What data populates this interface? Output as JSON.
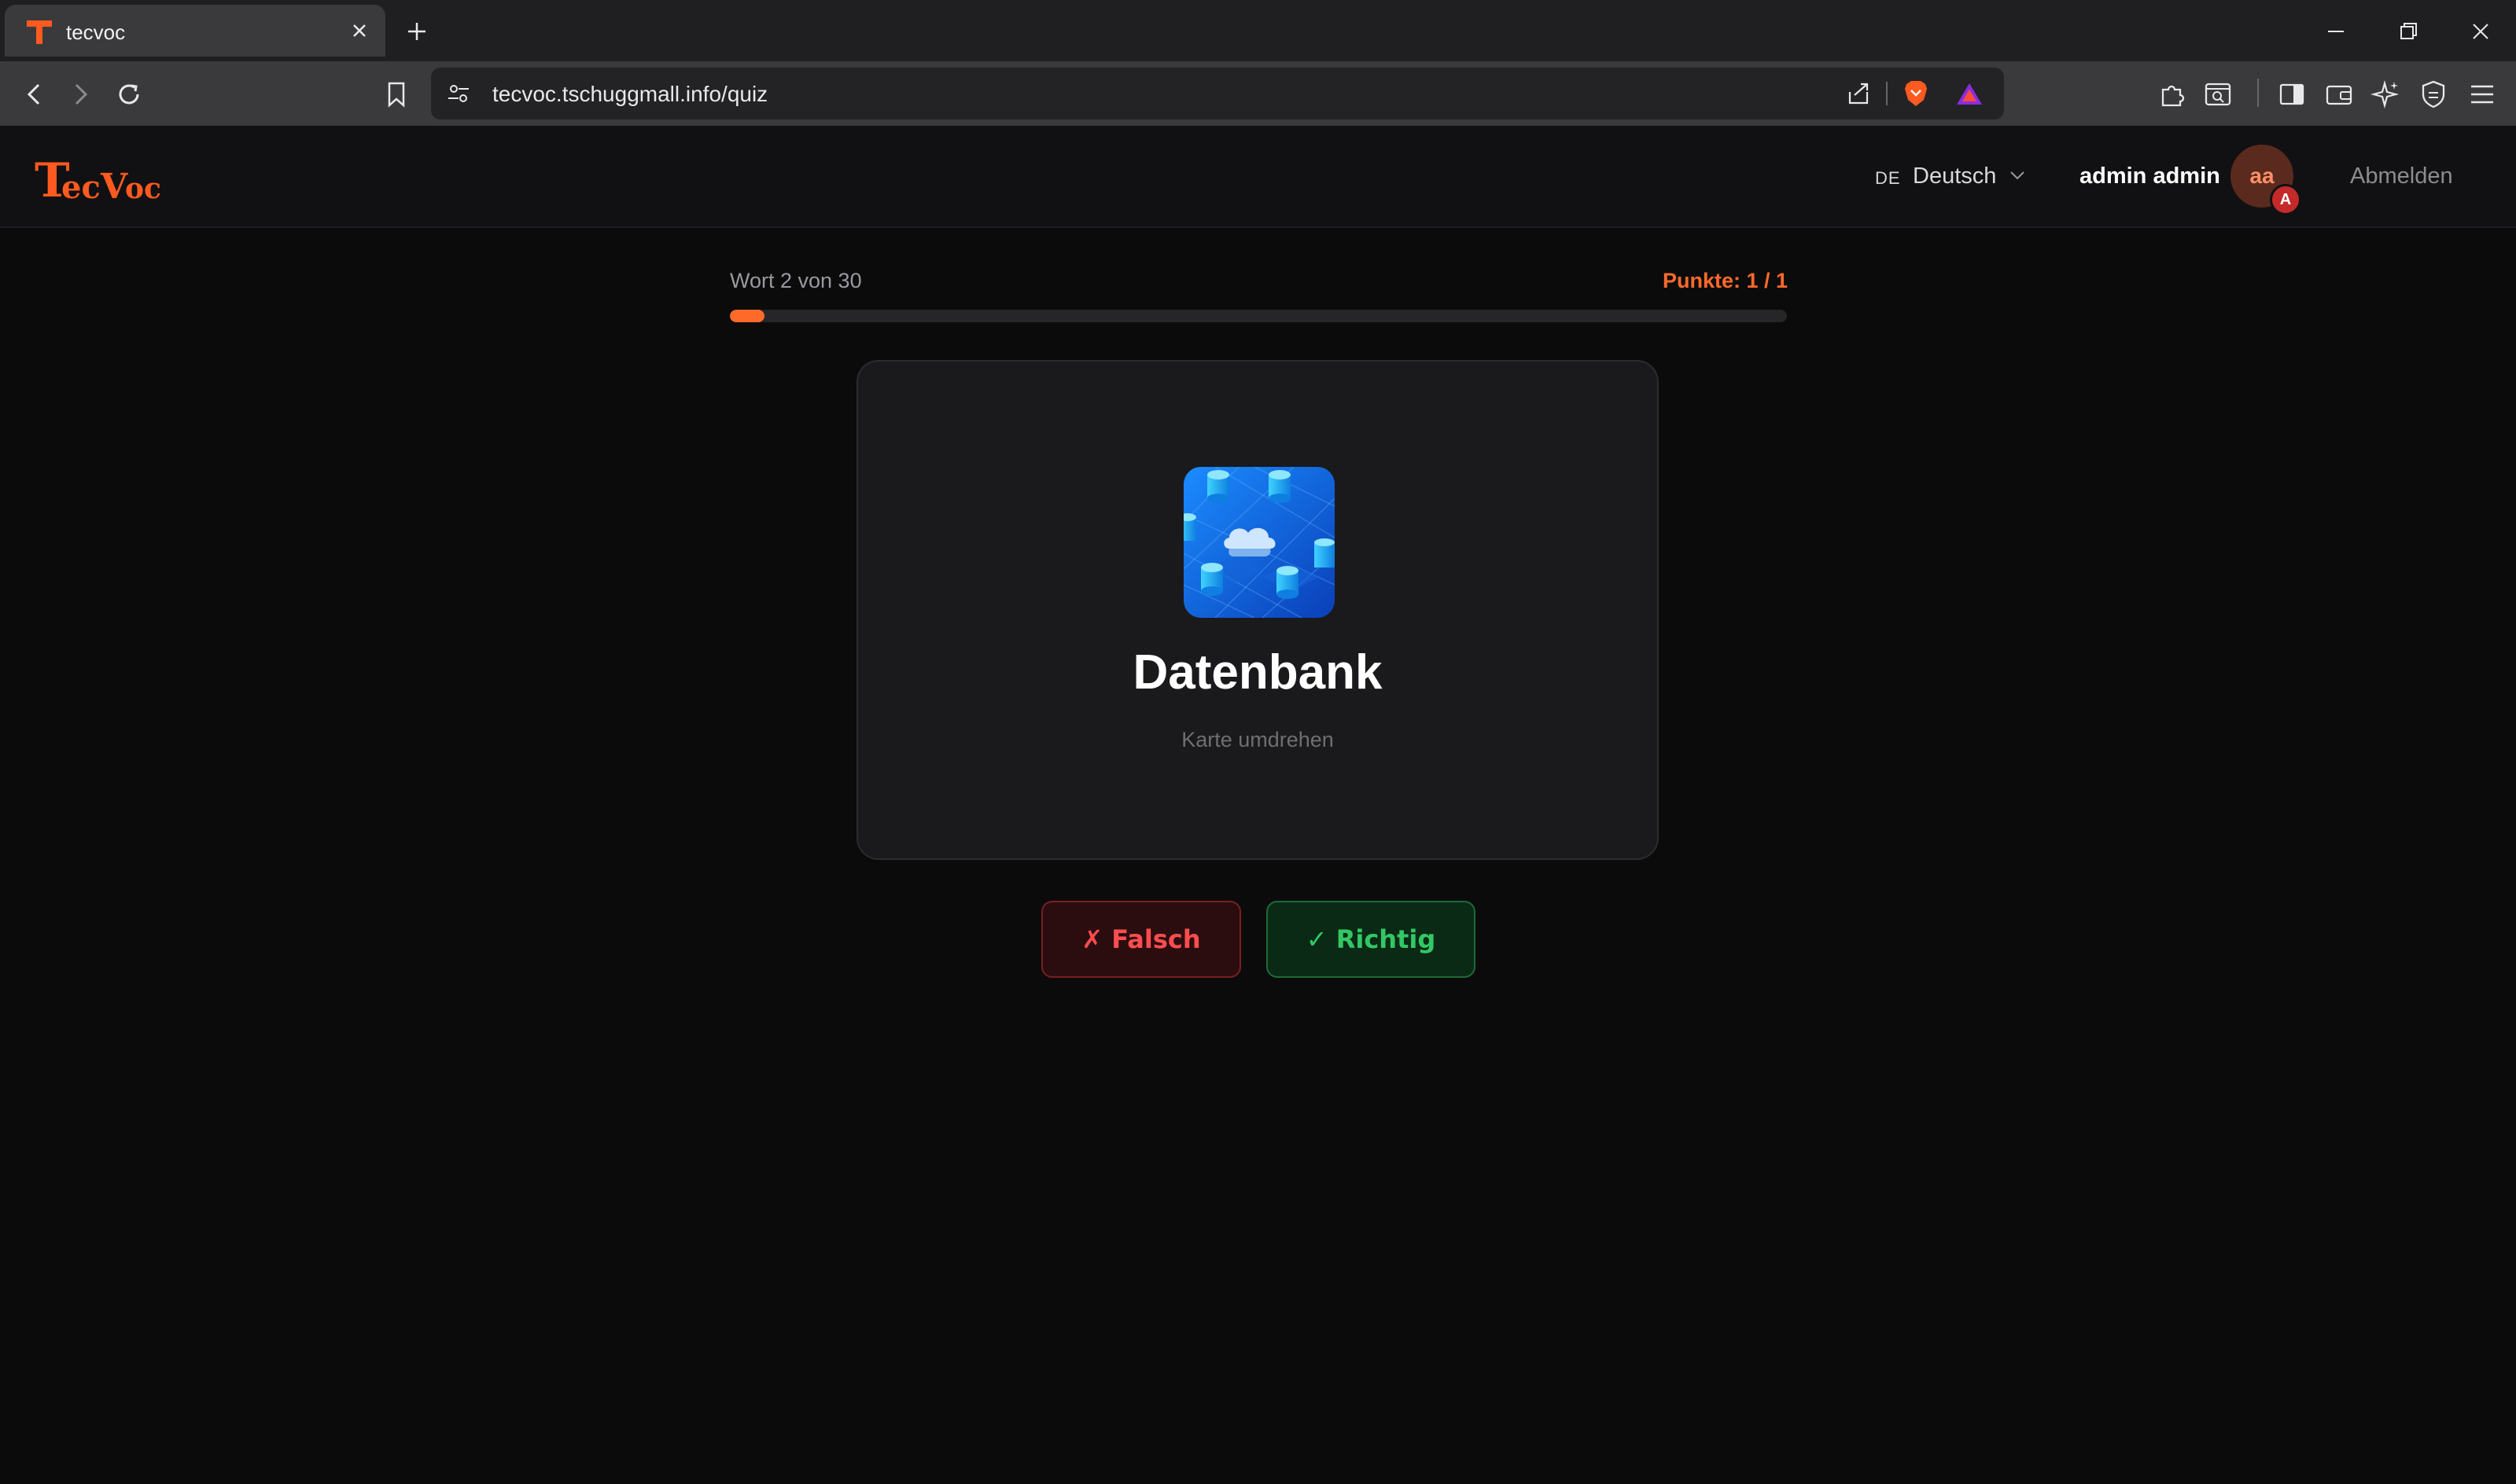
{
  "browser": {
    "tab_title": "tecvoc",
    "url": "tecvoc.tschuggmall.info/quiz"
  },
  "header": {
    "logo_text": "TecVoc",
    "language_code": "DE",
    "language_label": "Deutsch",
    "username": "admin admin",
    "avatar_initials": "aa",
    "avatar_badge": "A",
    "logout_label": "Abmelden"
  },
  "quiz": {
    "progress_text": "Wort 2 von 30",
    "score_text": "Punkte: 1 / 1",
    "progress_fraction": 0.033,
    "word": "Datenbank",
    "flip_hint": "Karte umdrehen",
    "image_icon": "cloud-database-image",
    "wrong_label": "✗ Falsch",
    "right_label": "✓ Richtig"
  },
  "colors": {
    "accent": "#ff6a2b",
    "wrong": "#ff4d4f",
    "right": "#32c864",
    "background": "#0b0b0c"
  }
}
